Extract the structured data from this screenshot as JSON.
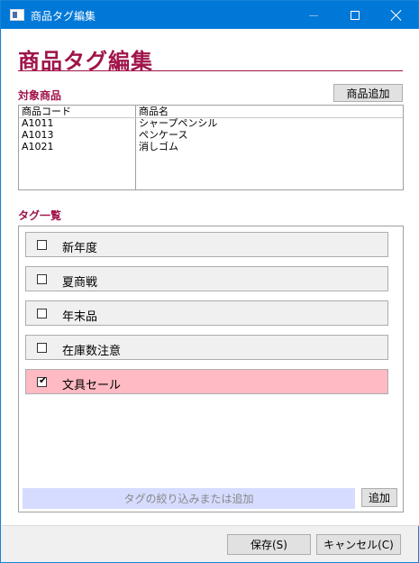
{
  "window": {
    "title": "商品タグ編集",
    "controls": {
      "minimize": "minimize-icon",
      "maximize": "maximize-icon",
      "close": "close-icon"
    }
  },
  "page": {
    "heading": "商品タグ編集"
  },
  "products": {
    "section_label": "対象商品",
    "add_button": "商品追加",
    "columns": [
      "商品コード",
      "商品名"
    ],
    "rows": [
      {
        "code": "A1011",
        "name": "シャープペンシル"
      },
      {
        "code": "A1013",
        "name": "ペンケース"
      },
      {
        "code": "A1021",
        "name": "消しゴム"
      }
    ]
  },
  "tags": {
    "section_label": "タグ一覧",
    "items": [
      {
        "label": "新年度",
        "checked": false
      },
      {
        "label": "夏商戦",
        "checked": false
      },
      {
        "label": "年末品",
        "checked": false
      },
      {
        "label": "在庫数注意",
        "checked": false
      },
      {
        "label": "文具セール",
        "checked": true
      }
    ],
    "filter_placeholder": "タグの絞り込みまたは追加",
    "add_button": "追加"
  },
  "footer": {
    "save_button": "保存(S)",
    "cancel_button": "キャンセル(C)"
  },
  "colors": {
    "accent": "#a0144a",
    "titlebar": "#0078d7",
    "checked_tag": "#ffbac3",
    "filter_bg": "#d6dcff"
  }
}
